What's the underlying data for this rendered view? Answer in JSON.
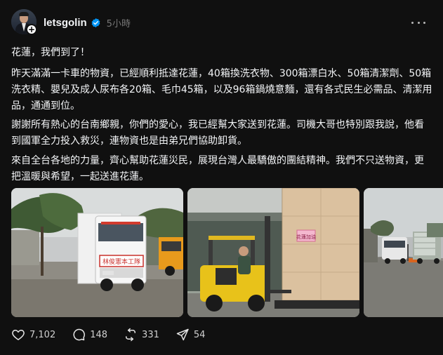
{
  "post": {
    "username": "letsgolin",
    "timestamp": "5小時",
    "paragraphs": [
      "花蓮，我們到了！",
      "昨天滿滿一卡車的物資，已經順利抵達花蓮，40箱換洗衣物、300箱漂白水、50箱清潔劑、50箱洗衣精、嬰兒及成人尿布各20箱、毛巾45箱，以及96箱鍋燒意麵，還有各式民生必需品、清潔用品，通通到位。",
      "謝謝所有熱心的台南鄉親，你們的愛心，我已經幫大家送到花蓮。司機大哥也特別跟我說，他看到國軍全力投入救災，連物資也是由弟兄們協助卸貨。",
      "來自全台各地的力量，齊心幫助花蓮災民，展現台灣人最驕傲的團結精神。我們不只送物資，更把溫暖與希望，一起送進花蓮。"
    ],
    "images": [
      {
        "icon": "truck-photo",
        "banner_text": "林俊憲本工隊"
      },
      {
        "icon": "forklift-photo",
        "sign_text": "花蓮加油"
      },
      {
        "icon": "street-trucks-photo"
      }
    ]
  },
  "actions": {
    "likes": "7,102",
    "comments": "148",
    "reposts": "331",
    "shares": "54"
  },
  "colors": {
    "background": "#101010",
    "text": "#f3f5f7",
    "muted": "#777777",
    "verified": "#0095f6"
  }
}
